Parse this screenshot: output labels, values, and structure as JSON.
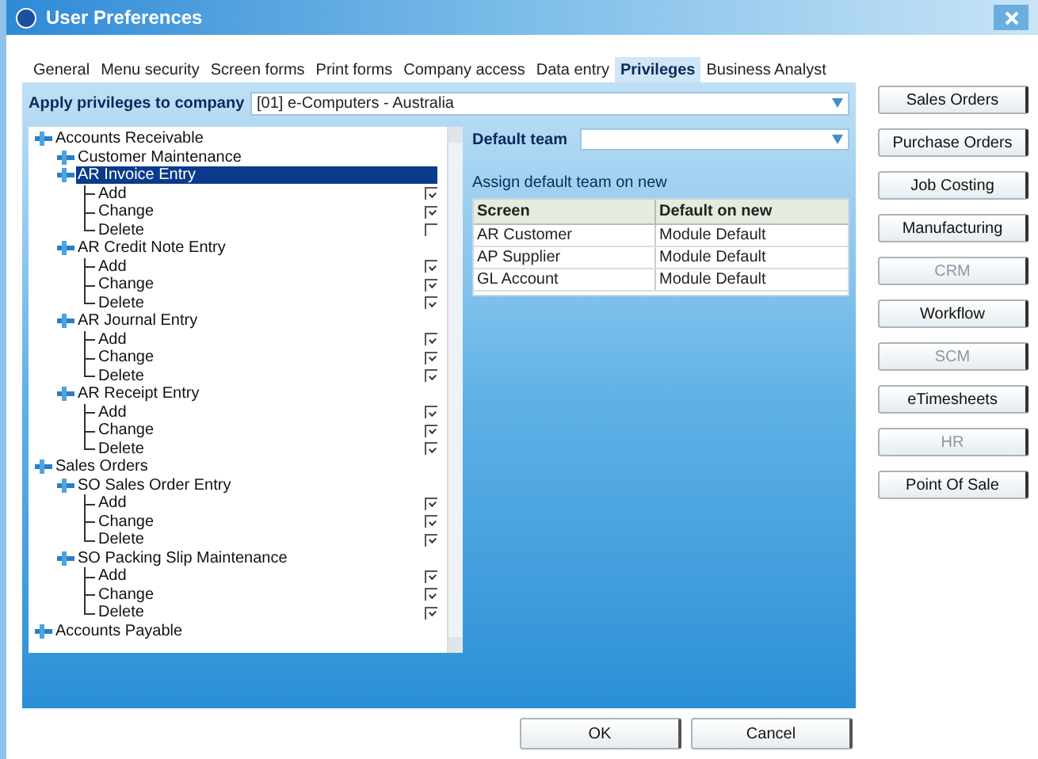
{
  "window": {
    "title": "User Preferences"
  },
  "tabs": [
    {
      "label": "General",
      "selected": false
    },
    {
      "label": "Menu security",
      "selected": false
    },
    {
      "label": "Screen forms",
      "selected": false
    },
    {
      "label": "Print forms",
      "selected": false
    },
    {
      "label": "Company access",
      "selected": false
    },
    {
      "label": "Data entry",
      "selected": false
    },
    {
      "label": "Privileges",
      "selected": true
    },
    {
      "label": "Business Analyst",
      "selected": false
    }
  ],
  "company": {
    "label": "Apply privileges to company",
    "value": "[01] e-Computers - Australia"
  },
  "tree": [
    {
      "label": "Accounts Receivable",
      "selected": false,
      "children": [
        {
          "label": "Customer Maintenance",
          "selected": false
        },
        {
          "label": "AR Invoice Entry",
          "selected": true,
          "children": [
            {
              "label": "Add",
              "selected": false,
              "checked": true
            },
            {
              "label": "Change",
              "selected": false,
              "checked": true
            },
            {
              "label": "Delete",
              "selected": false,
              "checked": false
            }
          ]
        },
        {
          "label": "AR Credit Note Entry",
          "selected": false,
          "children": [
            {
              "label": "Add",
              "selected": false,
              "checked": true
            },
            {
              "label": "Change",
              "selected": false,
              "checked": true
            },
            {
              "label": "Delete",
              "selected": false,
              "checked": true
            }
          ]
        },
        {
          "label": "AR Journal Entry",
          "selected": false,
          "children": [
            {
              "label": "Add",
              "selected": false,
              "checked": true
            },
            {
              "label": "Change",
              "selected": false,
              "checked": true
            },
            {
              "label": "Delete",
              "selected": false,
              "checked": true
            }
          ]
        },
        {
          "label": "AR Receipt Entry",
          "selected": false,
          "children": [
            {
              "label": "Add",
              "selected": false,
              "checked": true
            },
            {
              "label": "Change",
              "selected": false,
              "checked": true
            },
            {
              "label": "Delete",
              "selected": false,
              "checked": true
            }
          ]
        }
      ]
    },
    {
      "label": "Sales Orders",
      "selected": false,
      "children": [
        {
          "label": "SO Sales Order Entry",
          "selected": false,
          "children": [
            {
              "label": "Add",
              "selected": false,
              "checked": true
            },
            {
              "label": "Change",
              "selected": false,
              "checked": true
            },
            {
              "label": "Delete",
              "selected": false,
              "checked": true
            }
          ]
        },
        {
          "label": "SO Packing Slip Maintenance",
          "selected": false,
          "children": [
            {
              "label": "Add",
              "selected": false,
              "checked": true
            },
            {
              "label": "Change",
              "selected": false,
              "checked": true
            },
            {
              "label": "Delete",
              "selected": false,
              "checked": true
            }
          ]
        }
      ]
    },
    {
      "label": "Accounts Payable",
      "selected": false
    }
  ],
  "default_team": {
    "label": "Default team"
  },
  "assign": {
    "title": "Assign default team on new",
    "columns": [
      "Screen",
      "Default on new"
    ],
    "rows": [
      [
        "AR Customer",
        "Module Default"
      ],
      [
        "AP Supplier",
        "Module Default"
      ],
      [
        "GL Account",
        "Module Default"
      ]
    ]
  },
  "side_buttons": [
    {
      "label": "Sales Orders",
      "disabled": false
    },
    {
      "label": "Purchase Orders",
      "disabled": false
    },
    {
      "label": "Job Costing",
      "disabled": false
    },
    {
      "label": "Manufacturing",
      "disabled": false
    },
    {
      "label": "CRM",
      "disabled": true
    },
    {
      "label": "Workflow",
      "disabled": false
    },
    {
      "label": "SCM",
      "disabled": true
    },
    {
      "label": "eTimesheets",
      "disabled": false
    },
    {
      "label": "HR",
      "disabled": true
    },
    {
      "label": "Point Of Sale",
      "disabled": false
    }
  ],
  "buttons": [
    "OK",
    "Cancel"
  ]
}
